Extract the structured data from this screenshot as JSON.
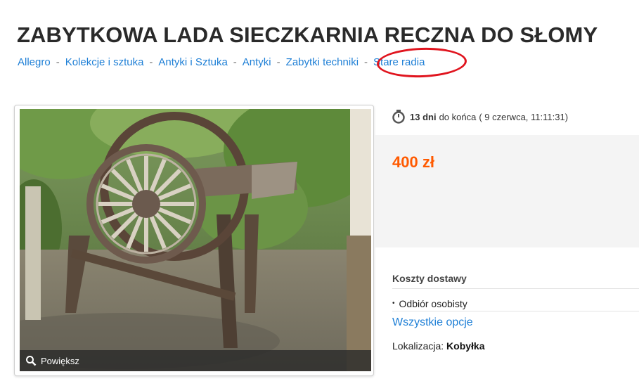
{
  "title": "ZABYTKOWA LADA SIECZKARNIA RECZNA DO SŁOMY",
  "breadcrumb": {
    "items": [
      "Allegro",
      "Kolekcje i sztuka",
      "Antyki i Sztuka",
      "Antyki",
      "Zabytki techniki",
      "Stare radia"
    ],
    "separator": "-"
  },
  "photo": {
    "zoom_label": "Powiększ"
  },
  "auction": {
    "days": "13 dni",
    "remaining_suffix": "do końca",
    "end_date": "( 9 czerwca, 11:11:31)"
  },
  "price": "400 zł",
  "shipping": {
    "title": "Koszty dostawy",
    "option": "Odbiór osobisty",
    "all_options": "Wszystkie opcje"
  },
  "location": {
    "label": "Lokalizacja:",
    "value": "Kobyłka"
  },
  "colors": {
    "link": "#1e7fd6",
    "price": "#ff5a00",
    "annotation": "#e0141e"
  }
}
